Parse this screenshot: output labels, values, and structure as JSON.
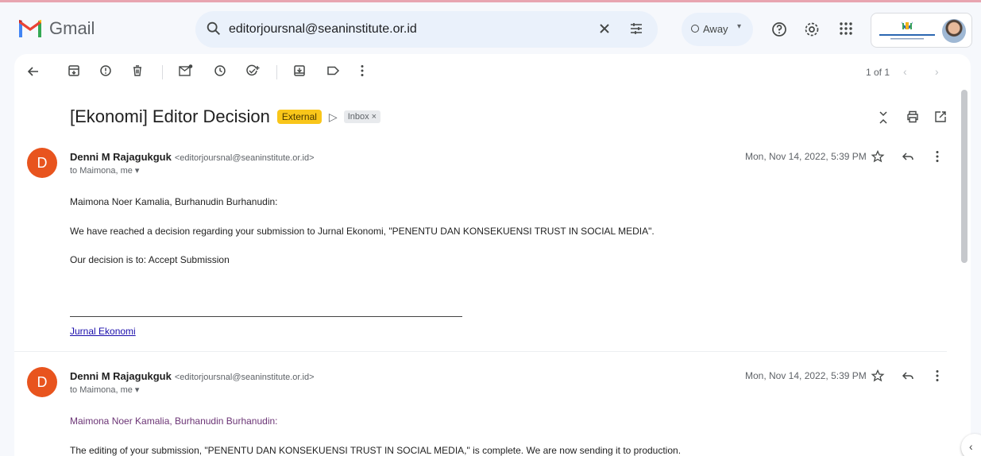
{
  "app": {
    "name": "Gmail"
  },
  "search": {
    "query": "editorjoursnal@seaninstitute.or.id"
  },
  "status": {
    "label": "Away"
  },
  "pager": {
    "label": "1 of 1"
  },
  "thread": {
    "subject": "[Ekonomi] Editor Decision",
    "labels": {
      "external": "External",
      "inbox": "Inbox ×"
    }
  },
  "messages": [
    {
      "avatar_letter": "D",
      "sender_name": "Denni M Rajagukguk",
      "sender_email": "<editorjoursnal@seaninstitute.or.id>",
      "to": "to Maimona, me ▾",
      "date": "Mon, Nov 14, 2022, 5:39 PM",
      "lines": [
        "Maimona Noer Kamalia, Burhanudin Burhanudin:",
        "We have reached a decision regarding your submission to Jurnal Ekonomi, \"PENENTU DAN KONSEKUENSI TRUST IN SOCIAL MEDIA\".",
        "Our decision is to: Accept Submission"
      ],
      "link": "Jurnal Ekonomi"
    },
    {
      "avatar_letter": "D",
      "sender_name": "Denni M Rajagukguk",
      "sender_email": "<editorjoursnal@seaninstitute.or.id>",
      "to": "to Maimona, me ▾",
      "date": "Mon, Nov 14, 2022, 5:39 PM",
      "lines": [
        "Maimona Noer Kamalia, Burhanudin Burhanudin:",
        "The editing of your submission, \"PENENTU DAN KONSEKUENSI TRUST IN SOCIAL MEDIA,\" is complete. We are now sending it to production."
      ]
    }
  ],
  "colors": {
    "accent": "#e8541e",
    "external_badge": "#f9c61a",
    "link": "#1a0dab"
  }
}
